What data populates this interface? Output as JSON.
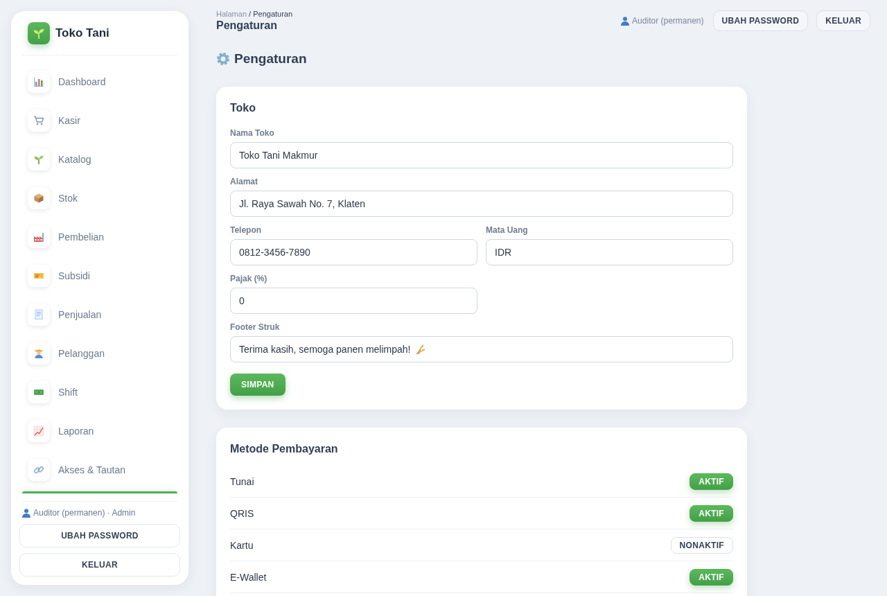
{
  "sidebar": {
    "brand": "Toko Tani",
    "nav_items": [
      {
        "label": "Dashboard",
        "selected": false
      },
      {
        "label": "Kasir",
        "selected": false
      },
      {
        "label": "Katalog",
        "selected": false
      },
      {
        "label": "Stok",
        "selected": false
      },
      {
        "label": "Pembelian",
        "selected": false
      },
      {
        "label": "Subsidi",
        "selected": false
      },
      {
        "label": "Penjualan",
        "selected": false
      },
      {
        "label": "Pelanggan",
        "selected": false
      },
      {
        "label": "Shift",
        "selected": false
      },
      {
        "label": "Laporan",
        "selected": false
      },
      {
        "label": "Akses & Tautan",
        "selected": false
      }
    ],
    "user": "Auditor (permanen) · Admin",
    "buttons": [
      "UBAH PASSWORD",
      "KELUAR"
    ]
  },
  "topbar": {
    "breadcrumb": {
      "parent": "Halaman",
      "separator": "/",
      "current": "Pengaturan"
    },
    "title": "Pengaturan",
    "user": "Auditor (permanen)",
    "buttons": [
      "UBAH PASSWORD",
      "KELUAR"
    ]
  },
  "page_heading": "Pengaturan",
  "store_card": {
    "title": "Toko",
    "rows": [
      [
        {
          "label": "Nama Toko",
          "value": "Toko Tani Makmur",
          "kind": "text"
        }
      ],
      [
        {
          "label": "Alamat",
          "value": "Jl. Raya Sawah No. 7, Klaten",
          "kind": "text"
        }
      ],
      [
        {
          "label": "Telepon",
          "value": "0812-3456-7890",
          "kind": "text"
        },
        {
          "label": "Mata Uang",
          "value": "IDR",
          "kind": "text"
        }
      ],
      [
        {
          "label": "Pajak (%)",
          "value": "0",
          "kind": "number"
        }
      ],
      [
        {
          "label": "Footer Struk",
          "value": "Terima kasih, semoga panen melimpah!",
          "kind": "message"
        }
      ]
    ],
    "save_button": "SIMPAN"
  },
  "payment_card": {
    "title": "Metode Pembayaran",
    "methods": [
      {
        "name": "Tunai",
        "active": true,
        "status": "AKTIF"
      },
      {
        "name": "QRIS",
        "active": true,
        "status": "AKTIF"
      },
      {
        "name": "Kartu",
        "active": false,
        "status": "NONAKTIF"
      },
      {
        "name": "E-Wallet",
        "active": true,
        "status": "AKTIF"
      }
    ]
  }
}
